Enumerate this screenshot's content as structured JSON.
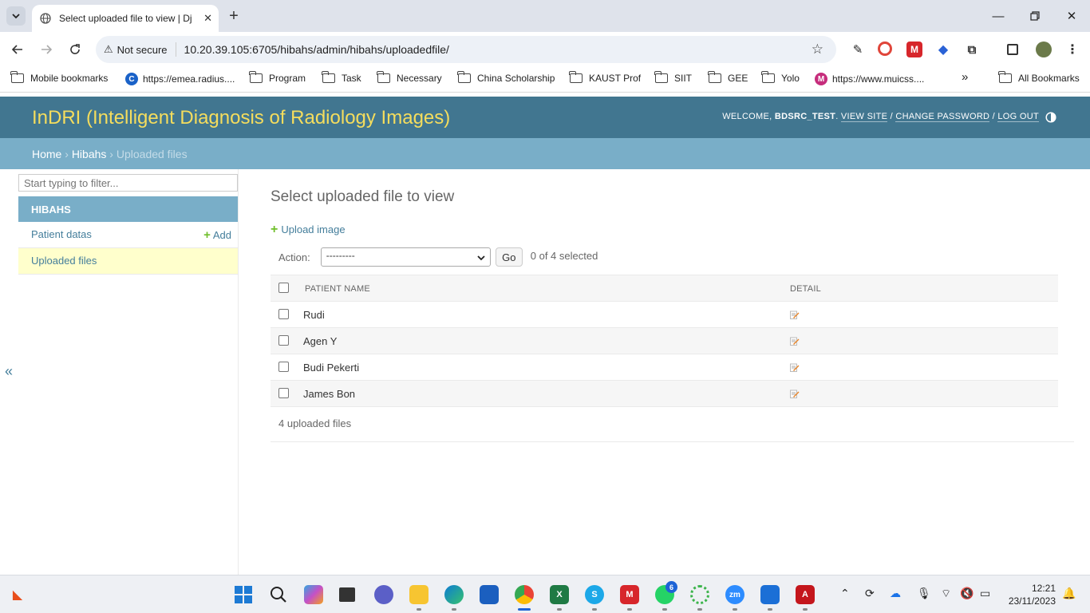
{
  "browser": {
    "tab_title": "Select uploaded file to view | Dj",
    "security_label": "Not secure",
    "url": "10.20.39.105:6705/hibahs/admin/hibahs/uploadedfile/",
    "bookmarks": [
      {
        "label": "Mobile bookmarks",
        "icon": "folder-icon"
      },
      {
        "label": "https://emea.radius....",
        "icon": "c-logo-icon"
      },
      {
        "label": "Program",
        "icon": "folder-icon"
      },
      {
        "label": "Task",
        "icon": "folder-icon"
      },
      {
        "label": "Necessary",
        "icon": "folder-icon"
      },
      {
        "label": "China Scholarship",
        "icon": "folder-icon"
      },
      {
        "label": "KAUST Prof",
        "icon": "folder-icon"
      },
      {
        "label": "SIIT",
        "icon": "folder-icon"
      },
      {
        "label": "GEE",
        "icon": "folder-icon"
      },
      {
        "label": "Yolo",
        "icon": "folder-icon"
      },
      {
        "label": "https://www.muicss....",
        "icon": "m-logo-icon"
      }
    ],
    "all_bookmarks_label": "All Bookmarks",
    "more_bookmarks_label": "»"
  },
  "admin": {
    "site_name": "InDRI (Intelligent Diagnosis of Radiology Images)",
    "welcome_prefix": "WELCOME,",
    "username": "BDSRC_TEST",
    "view_site": "VIEW SITE",
    "change_password": "CHANGE PASSWORD",
    "log_out": "LOG OUT",
    "breadcrumbs": {
      "home": "Home",
      "app": "Hibahs",
      "current": "Uploaded files",
      "sep": "›"
    },
    "nav_filter_placeholder": "Start typing to filter...",
    "app_caption": "HIBAHS",
    "models": [
      {
        "label": "Patient datas",
        "add_label": "Add"
      },
      {
        "label": "Uploaded files",
        "add_label": ""
      }
    ],
    "collapse_label": "«",
    "page_title": "Select uploaded file to view",
    "upload_label": "Upload image",
    "action_label": "Action:",
    "action_selected": "---------",
    "go_label": "Go",
    "selection_count": "0 of 4 selected",
    "columns": [
      "PATIENT NAME",
      "DETAIL"
    ],
    "rows": [
      {
        "patient_name": "Rudi"
      },
      {
        "patient_name": "Agen Y"
      },
      {
        "patient_name": "Budi Pekerti"
      },
      {
        "patient_name": "James Bon"
      }
    ],
    "paginator": "4 uploaded files",
    "colors": {
      "header_bg": "#417690",
      "site_name": "#f5dd5d",
      "breadcrumbs_bg": "#79aec8",
      "link": "#447e9b",
      "selected_row": "#ffffcc",
      "add_green": "#70bf2b"
    }
  },
  "taskbar": {
    "time": "12:21",
    "date": "23/11/2023",
    "whatsapp_badge": "6"
  }
}
